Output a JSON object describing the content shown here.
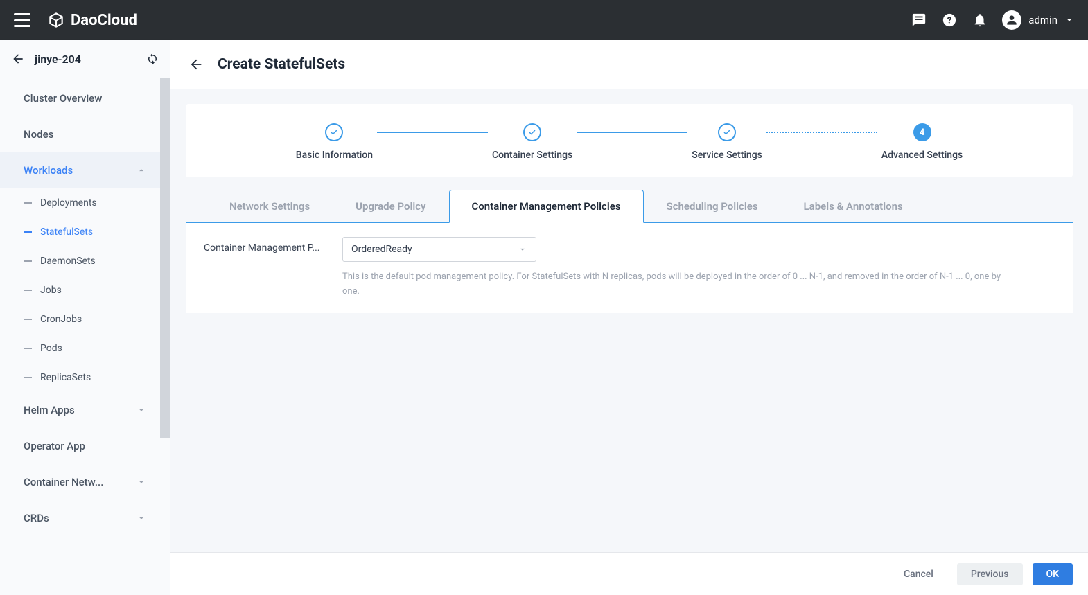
{
  "brand": {
    "name": "DaoCloud"
  },
  "user": {
    "name": "admin"
  },
  "sidebar": {
    "cluster": "jinye-204",
    "items": [
      {
        "label": "Cluster Overview"
      },
      {
        "label": "Nodes"
      },
      {
        "label": "Workloads",
        "active": true,
        "expandable": true
      }
    ],
    "workloads": [
      {
        "label": "Deployments"
      },
      {
        "label": "StatefulSets",
        "active": true
      },
      {
        "label": "DaemonSets"
      },
      {
        "label": "Jobs"
      },
      {
        "label": "CronJobs"
      },
      {
        "label": "Pods"
      },
      {
        "label": "ReplicaSets"
      }
    ],
    "after": [
      {
        "label": "Helm Apps",
        "expandable": true
      },
      {
        "label": "Operator App"
      },
      {
        "label": "Container Netw...",
        "expandable": true
      },
      {
        "label": "CRDs",
        "expandable": true
      }
    ]
  },
  "page": {
    "title": "Create StatefulSets"
  },
  "stepper": {
    "steps": [
      {
        "label": "Basic Information",
        "state": "done"
      },
      {
        "label": "Container Settings",
        "state": "done"
      },
      {
        "label": "Service Settings",
        "state": "done"
      },
      {
        "label": "Advanced Settings",
        "state": "current",
        "num": "4"
      }
    ]
  },
  "tabs": [
    {
      "label": "Network Settings"
    },
    {
      "label": "Upgrade Policy"
    },
    {
      "label": "Container Management Policies",
      "active": true
    },
    {
      "label": "Scheduling Policies"
    },
    {
      "label": "Labels & Annotations"
    }
  ],
  "form": {
    "label": "Container Management P...",
    "select_value": "OrderedReady",
    "help": "This is the default pod management policy. For StatefulSets with N replicas, pods will be deployed in the order of 0 ... N-1, and removed in the order of N-1 ... 0, one by one."
  },
  "footer": {
    "cancel": "Cancel",
    "previous": "Previous",
    "ok": "OK"
  }
}
